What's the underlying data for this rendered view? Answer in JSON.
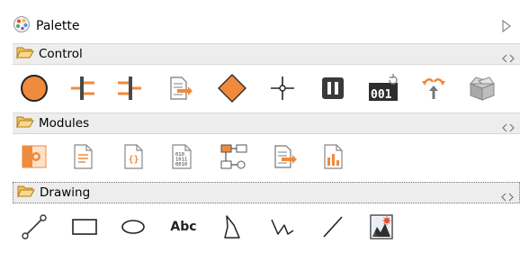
{
  "palette": {
    "title": "Palette"
  },
  "sections": {
    "control": {
      "label": "Control"
    },
    "modules": {
      "label": "Modules"
    },
    "drawing": {
      "label": "Drawing",
      "text_tool_label": "Abc"
    }
  },
  "colors": {
    "accent": "#f08a3c",
    "dark": "#3a3a3a",
    "folder": "#f3c160",
    "header_bg": "#ededed"
  }
}
